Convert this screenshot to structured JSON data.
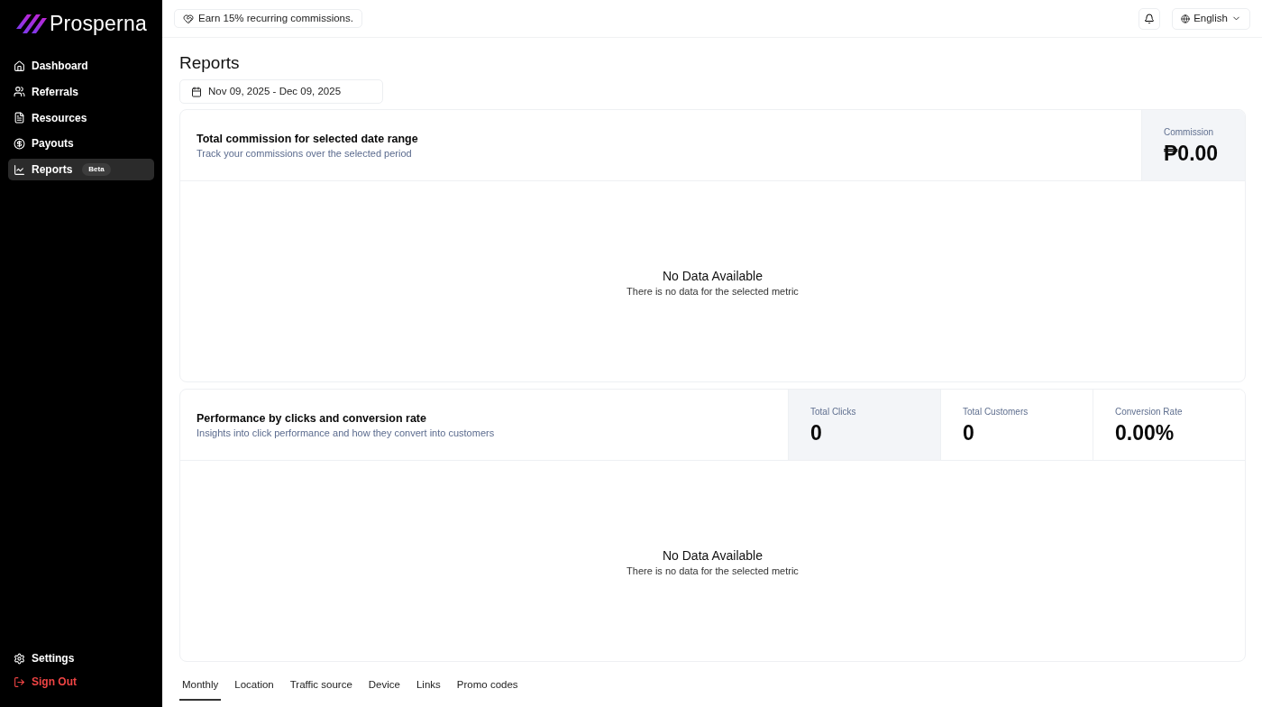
{
  "brand": {
    "name": "Prosperna"
  },
  "sidebar": {
    "items": [
      {
        "label": "Dashboard",
        "selected": false
      },
      {
        "label": "Referrals",
        "selected": false
      },
      {
        "label": "Resources",
        "selected": false
      },
      {
        "label": "Payouts",
        "selected": false
      },
      {
        "label": "Reports",
        "selected": true,
        "badge": "Beta"
      }
    ],
    "footer_items": [
      {
        "label": "Settings",
        "kind": "settings"
      },
      {
        "label": "Sign Out",
        "kind": "sign_out"
      }
    ]
  },
  "top_bar": {
    "promo": "Earn 15% recurring commissions.",
    "language": "English"
  },
  "page": {
    "title": "Reports",
    "date_range": "Nov 09, 2025 - Dec 09, 2025"
  },
  "cards": [
    {
      "title": "Total commission for selected date range",
      "subtitle": "Track your commissions over the selected period",
      "metrics": [
        {
          "label": "Commission",
          "value": "₱0.00",
          "selected": true
        }
      ],
      "empty_state": {
        "title": "No Data Available",
        "message": "There is no data for the selected metric"
      }
    },
    {
      "title": "Performance by clicks and conversion rate",
      "subtitle": "Insights into click performance and how they convert into customers",
      "metrics": [
        {
          "label": "Total Clicks",
          "value": "0",
          "selected": true
        },
        {
          "label": "Total Customers",
          "value": "0",
          "selected": false
        },
        {
          "label": "Conversion Rate",
          "value": "0.00%",
          "selected": false
        }
      ],
      "empty_state": {
        "title": "No Data Available",
        "message": "There is no data for the selected metric"
      }
    }
  ],
  "tabs": [
    {
      "label": "Monthly",
      "selected": true
    },
    {
      "label": "Location",
      "selected": false
    },
    {
      "label": "Traffic source",
      "selected": false
    },
    {
      "label": "Device",
      "selected": false
    },
    {
      "label": "Links",
      "selected": false
    },
    {
      "label": "Promo codes",
      "selected": false
    }
  ]
}
